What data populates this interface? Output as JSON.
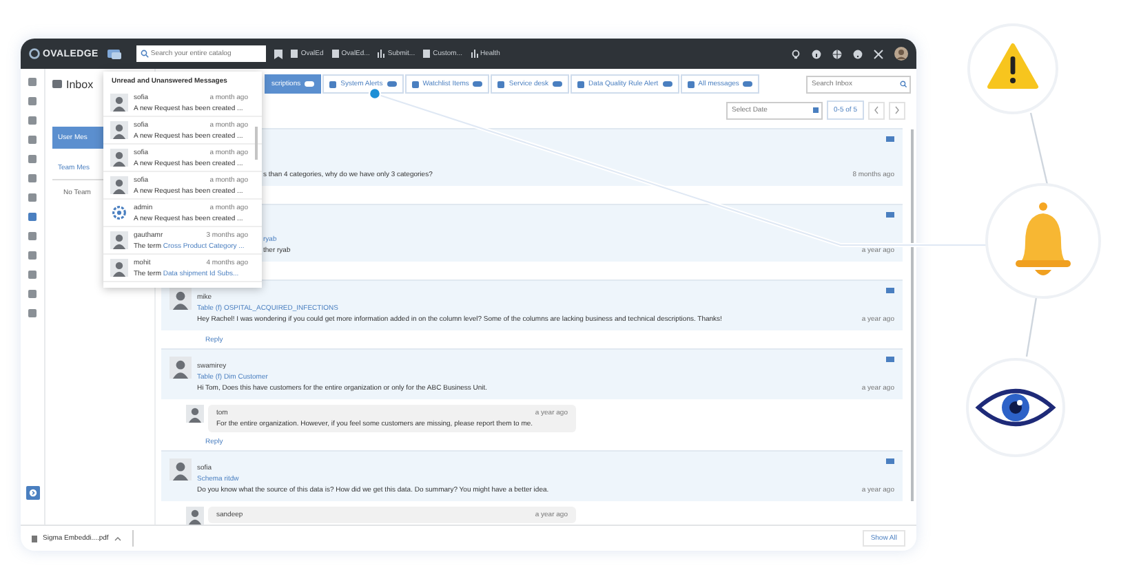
{
  "app": {
    "logo": "OVALEDGE",
    "search_placeholder": "Search your entire catalog",
    "nav": [
      "OvalEd",
      "OvalEd...",
      "Submit...",
      "Custom...",
      "Health"
    ]
  },
  "inbox": {
    "title": "Inbox",
    "buttons": [
      {
        "label": "User Mes",
        "selected": true
      },
      {
        "label": "Team Mes",
        "selected": false
      }
    ],
    "note": "No Team"
  },
  "tabs": [
    {
      "label": "scriptions",
      "selected": true
    },
    {
      "label": "System Alerts",
      "selected": false
    },
    {
      "label": "Watchlist Items",
      "selected": false
    },
    {
      "label": "Service desk",
      "selected": false
    },
    {
      "label": "Data Quality Rule Alert",
      "selected": false
    },
    {
      "label": "All messages",
      "selected": false
    }
  ],
  "search": {
    "placeholder": "Search Inbox"
  },
  "date": {
    "placeholder": "Select Date"
  },
  "pager": "0-5 of 5",
  "messages": [
    {
      "kind": "clipped",
      "text": "s than 4 categories, why do we have only 3 categories?",
      "time": "8 months ago"
    },
    {
      "kind": "clipped",
      "link": "ryab",
      "text": "ther ryab",
      "time": "a year ago"
    },
    {
      "kind": "message",
      "author": "mike",
      "link": "Table (f) OSPITAL_ACQUIRED_INFECTIONS",
      "text": "Hey Rachel! I was wondering if you could get more information added in on the column level? Some of the columns are lacking business and technical descriptions. Thanks!",
      "time": "a year ago",
      "reply": "Reply"
    },
    {
      "kind": "message",
      "author": "swamirey",
      "link": "Table (f) Dim Customer",
      "text": "Hi Tom, Does this have customers for the entire organization or only for the ABC Business Unit.",
      "time": "a year ago",
      "answers": [
        {
          "author": "tom",
          "time": "a year ago",
          "text": "For the entire organization. However, if you feel some customers are missing, please report them to me."
        }
      ],
      "reply": "Reply"
    },
    {
      "kind": "message",
      "author": "sofia",
      "link": "Schema ritdw",
      "text": "Do you know what the source of this data is? How did we get this data. Do summary? You might have a better idea.",
      "time": "a year ago",
      "answers": [
        {
          "author": "sandeep",
          "time": "a year ago"
        }
      ]
    }
  ],
  "dropdown": {
    "title": "Unread and Unanswered Messages",
    "items": [
      {
        "kind": "person",
        "author": "sofia",
        "time": "a month ago",
        "text": "A new Request has been created ..."
      },
      {
        "kind": "person",
        "author": "sofia",
        "time": "a month ago",
        "text": "A new Request has been created ..."
      },
      {
        "kind": "person",
        "author": "sofia",
        "time": "a month ago",
        "text": "A new Request has been created ..."
      },
      {
        "kind": "person",
        "author": "sofia",
        "time": "a month ago",
        "text": "A new Request has been created ..."
      },
      {
        "kind": "system",
        "author": "admin",
        "time": "a month ago",
        "text": "A new Request has been created ..."
      },
      {
        "kind": "person",
        "author": "gauthamr",
        "time": "3 months ago",
        "text": "The term ",
        "link": "Cross Product Category ..."
      },
      {
        "kind": "person",
        "author": "mohit",
        "time": "4 months ago",
        "text": "The term ",
        "link": "Data shipment Id Subs..."
      }
    ]
  },
  "download": {
    "file": "Sigma Embeddi....pdf",
    "show_all": "Show All"
  }
}
